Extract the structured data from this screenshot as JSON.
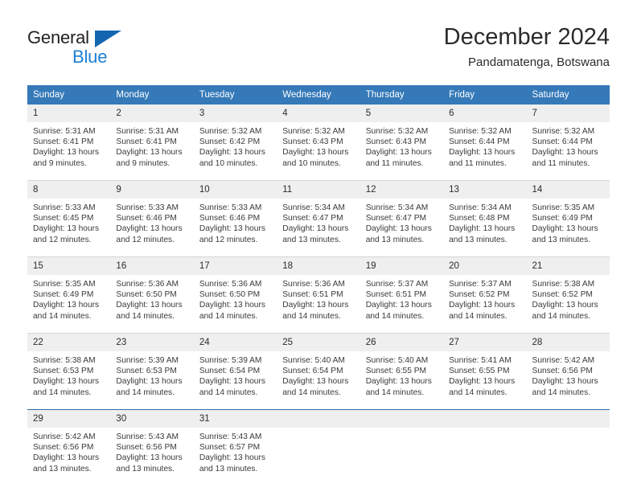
{
  "brand": {
    "name_part1": "General",
    "name_part2": "Blue",
    "triangle_icon": "blue-triangle-icon",
    "color_dark": "#231f20",
    "color_blue": "#1b7fd4"
  },
  "header": {
    "title": "December 2024",
    "subtitle": "Pandamatenga, Botswana"
  },
  "theme": {
    "header_bg": "#3579b8",
    "daynum_bg": "#efefef",
    "row_divider": "#d6d6d6",
    "last_row_divider": "#2f6da8",
    "text": "#2b2b2b"
  },
  "weekdays": [
    "Sunday",
    "Monday",
    "Tuesday",
    "Wednesday",
    "Thursday",
    "Friday",
    "Saturday"
  ],
  "weeks": [
    [
      {
        "day": "1",
        "sunrise": "Sunrise: 5:31 AM",
        "sunset": "Sunset: 6:41 PM",
        "daylight1": "Daylight: 13 hours",
        "daylight2": "and 9 minutes."
      },
      {
        "day": "2",
        "sunrise": "Sunrise: 5:31 AM",
        "sunset": "Sunset: 6:41 PM",
        "daylight1": "Daylight: 13 hours",
        "daylight2": "and 9 minutes."
      },
      {
        "day": "3",
        "sunrise": "Sunrise: 5:32 AM",
        "sunset": "Sunset: 6:42 PM",
        "daylight1": "Daylight: 13 hours",
        "daylight2": "and 10 minutes."
      },
      {
        "day": "4",
        "sunrise": "Sunrise: 5:32 AM",
        "sunset": "Sunset: 6:43 PM",
        "daylight1": "Daylight: 13 hours",
        "daylight2": "and 10 minutes."
      },
      {
        "day": "5",
        "sunrise": "Sunrise: 5:32 AM",
        "sunset": "Sunset: 6:43 PM",
        "daylight1": "Daylight: 13 hours",
        "daylight2": "and 11 minutes."
      },
      {
        "day": "6",
        "sunrise": "Sunrise: 5:32 AM",
        "sunset": "Sunset: 6:44 PM",
        "daylight1": "Daylight: 13 hours",
        "daylight2": "and 11 minutes."
      },
      {
        "day": "7",
        "sunrise": "Sunrise: 5:32 AM",
        "sunset": "Sunset: 6:44 PM",
        "daylight1": "Daylight: 13 hours",
        "daylight2": "and 11 minutes."
      }
    ],
    [
      {
        "day": "8",
        "sunrise": "Sunrise: 5:33 AM",
        "sunset": "Sunset: 6:45 PM",
        "daylight1": "Daylight: 13 hours",
        "daylight2": "and 12 minutes."
      },
      {
        "day": "9",
        "sunrise": "Sunrise: 5:33 AM",
        "sunset": "Sunset: 6:46 PM",
        "daylight1": "Daylight: 13 hours",
        "daylight2": "and 12 minutes."
      },
      {
        "day": "10",
        "sunrise": "Sunrise: 5:33 AM",
        "sunset": "Sunset: 6:46 PM",
        "daylight1": "Daylight: 13 hours",
        "daylight2": "and 12 minutes."
      },
      {
        "day": "11",
        "sunrise": "Sunrise: 5:34 AM",
        "sunset": "Sunset: 6:47 PM",
        "daylight1": "Daylight: 13 hours",
        "daylight2": "and 13 minutes."
      },
      {
        "day": "12",
        "sunrise": "Sunrise: 5:34 AM",
        "sunset": "Sunset: 6:47 PM",
        "daylight1": "Daylight: 13 hours",
        "daylight2": "and 13 minutes."
      },
      {
        "day": "13",
        "sunrise": "Sunrise: 5:34 AM",
        "sunset": "Sunset: 6:48 PM",
        "daylight1": "Daylight: 13 hours",
        "daylight2": "and 13 minutes."
      },
      {
        "day": "14",
        "sunrise": "Sunrise: 5:35 AM",
        "sunset": "Sunset: 6:49 PM",
        "daylight1": "Daylight: 13 hours",
        "daylight2": "and 13 minutes."
      }
    ],
    [
      {
        "day": "15",
        "sunrise": "Sunrise: 5:35 AM",
        "sunset": "Sunset: 6:49 PM",
        "daylight1": "Daylight: 13 hours",
        "daylight2": "and 14 minutes."
      },
      {
        "day": "16",
        "sunrise": "Sunrise: 5:36 AM",
        "sunset": "Sunset: 6:50 PM",
        "daylight1": "Daylight: 13 hours",
        "daylight2": "and 14 minutes."
      },
      {
        "day": "17",
        "sunrise": "Sunrise: 5:36 AM",
        "sunset": "Sunset: 6:50 PM",
        "daylight1": "Daylight: 13 hours",
        "daylight2": "and 14 minutes."
      },
      {
        "day": "18",
        "sunrise": "Sunrise: 5:36 AM",
        "sunset": "Sunset: 6:51 PM",
        "daylight1": "Daylight: 13 hours",
        "daylight2": "and 14 minutes."
      },
      {
        "day": "19",
        "sunrise": "Sunrise: 5:37 AM",
        "sunset": "Sunset: 6:51 PM",
        "daylight1": "Daylight: 13 hours",
        "daylight2": "and 14 minutes."
      },
      {
        "day": "20",
        "sunrise": "Sunrise: 5:37 AM",
        "sunset": "Sunset: 6:52 PM",
        "daylight1": "Daylight: 13 hours",
        "daylight2": "and 14 minutes."
      },
      {
        "day": "21",
        "sunrise": "Sunrise: 5:38 AM",
        "sunset": "Sunset: 6:52 PM",
        "daylight1": "Daylight: 13 hours",
        "daylight2": "and 14 minutes."
      }
    ],
    [
      {
        "day": "22",
        "sunrise": "Sunrise: 5:38 AM",
        "sunset": "Sunset: 6:53 PM",
        "daylight1": "Daylight: 13 hours",
        "daylight2": "and 14 minutes."
      },
      {
        "day": "23",
        "sunrise": "Sunrise: 5:39 AM",
        "sunset": "Sunset: 6:53 PM",
        "daylight1": "Daylight: 13 hours",
        "daylight2": "and 14 minutes."
      },
      {
        "day": "24",
        "sunrise": "Sunrise: 5:39 AM",
        "sunset": "Sunset: 6:54 PM",
        "daylight1": "Daylight: 13 hours",
        "daylight2": "and 14 minutes."
      },
      {
        "day": "25",
        "sunrise": "Sunrise: 5:40 AM",
        "sunset": "Sunset: 6:54 PM",
        "daylight1": "Daylight: 13 hours",
        "daylight2": "and 14 minutes."
      },
      {
        "day": "26",
        "sunrise": "Sunrise: 5:40 AM",
        "sunset": "Sunset: 6:55 PM",
        "daylight1": "Daylight: 13 hours",
        "daylight2": "and 14 minutes."
      },
      {
        "day": "27",
        "sunrise": "Sunrise: 5:41 AM",
        "sunset": "Sunset: 6:55 PM",
        "daylight1": "Daylight: 13 hours",
        "daylight2": "and 14 minutes."
      },
      {
        "day": "28",
        "sunrise": "Sunrise: 5:42 AM",
        "sunset": "Sunset: 6:56 PM",
        "daylight1": "Daylight: 13 hours",
        "daylight2": "and 14 minutes."
      }
    ],
    [
      {
        "day": "29",
        "sunrise": "Sunrise: 5:42 AM",
        "sunset": "Sunset: 6:56 PM",
        "daylight1": "Daylight: 13 hours",
        "daylight2": "and 13 minutes."
      },
      {
        "day": "30",
        "sunrise": "Sunrise: 5:43 AM",
        "sunset": "Sunset: 6:56 PM",
        "daylight1": "Daylight: 13 hours",
        "daylight2": "and 13 minutes."
      },
      {
        "day": "31",
        "sunrise": "Sunrise: 5:43 AM",
        "sunset": "Sunset: 6:57 PM",
        "daylight1": "Daylight: 13 hours",
        "daylight2": "and 13 minutes."
      },
      {
        "day": "",
        "sunrise": "",
        "sunset": "",
        "daylight1": "",
        "daylight2": ""
      },
      {
        "day": "",
        "sunrise": "",
        "sunset": "",
        "daylight1": "",
        "daylight2": ""
      },
      {
        "day": "",
        "sunrise": "",
        "sunset": "",
        "daylight1": "",
        "daylight2": ""
      },
      {
        "day": "",
        "sunrise": "",
        "sunset": "",
        "daylight1": "",
        "daylight2": ""
      }
    ]
  ]
}
